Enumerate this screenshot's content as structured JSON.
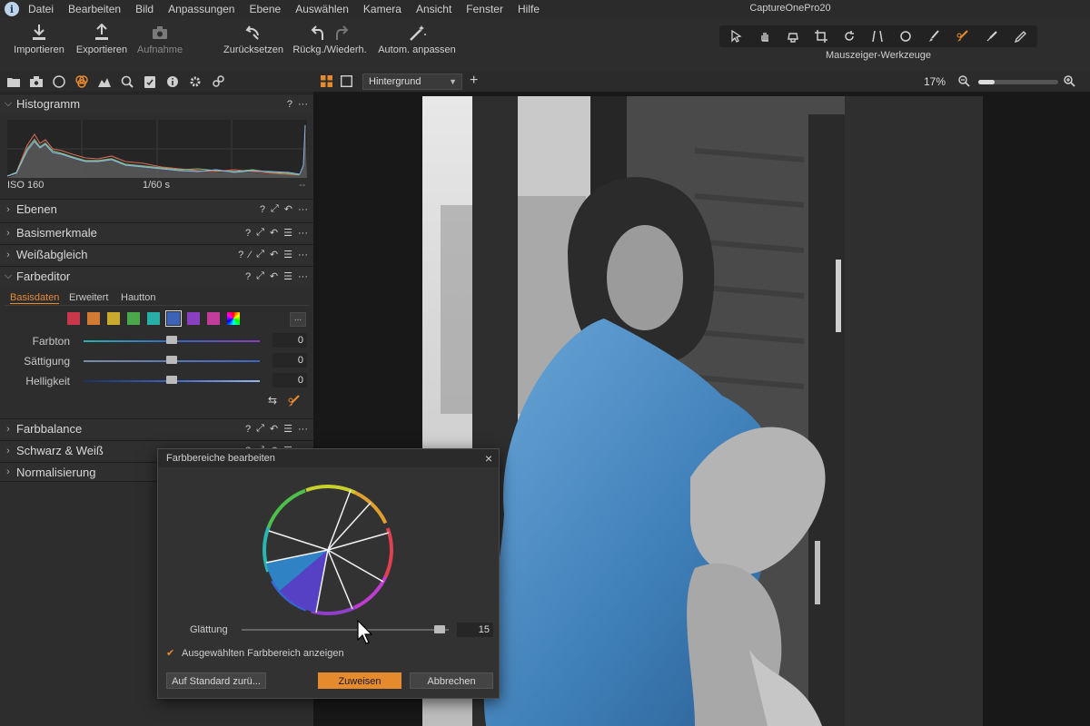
{
  "menu": {
    "items": [
      "Datei",
      "Bearbeiten",
      "Bild",
      "Anpassungen",
      "Ebene",
      "Auswählen",
      "Kamera",
      "Ansicht",
      "Fenster",
      "Hilfe"
    ],
    "app_title": "CaptureOnePro20"
  },
  "toolbar": {
    "import_label": "Importieren",
    "export_label": "Exportieren",
    "capture_label": "Aufnahme",
    "reset_label": "Zurücksetzen",
    "undo_redo_label": "Rückg./Wiederh.",
    "auto_adjust_label": "Autom. anpassen",
    "cursor_tools_label": "Mauszeiger-Werkzeuge"
  },
  "left_panel": {
    "histogram": {
      "title": "Histogramm",
      "iso": "ISO 160",
      "shutter": "1/60 s",
      "extra": "--"
    },
    "sections": {
      "layers": "Ebenen",
      "basic": "Basismerkmale",
      "white_balance": "Weißabgleich",
      "color_editor": "Farbeditor",
      "color_balance": "Farbbalance",
      "black_white": "Schwarz & Weiß",
      "normalize": "Normalisierung"
    },
    "color_editor": {
      "tabs": [
        "Basisdaten",
        "Erweitert",
        "Hautton"
      ],
      "more_button": "...",
      "swatch_colors": [
        "#c8384a",
        "#d07a34",
        "#c9aa2e",
        "#4aa84a",
        "#2aaea8",
        "#3d63b8",
        "#8a3fc0",
        "#c23c9c"
      ],
      "sliders": [
        {
          "label": "Farbton",
          "value": "0"
        },
        {
          "label": "Sättigung",
          "value": "0"
        },
        {
          "label": "Helligkeit",
          "value": "0"
        }
      ]
    }
  },
  "viewer": {
    "layer_select": "Hintergrund",
    "zoom": "17%"
  },
  "dialog": {
    "title": "Farbbereiche bearbeiten",
    "smoothing_label": "Glättung",
    "smoothing_value": "15",
    "show_range_label": "Ausgewählten Farbbereich anzeigen",
    "default_button": "Auf Standard zurü...",
    "assign_button": "Zuweisen",
    "cancel_button": "Abbrechen"
  },
  "colors": {
    "accent": "#e68a2e",
    "panel": "#2d2d2d",
    "background": "#1e1e1e"
  }
}
